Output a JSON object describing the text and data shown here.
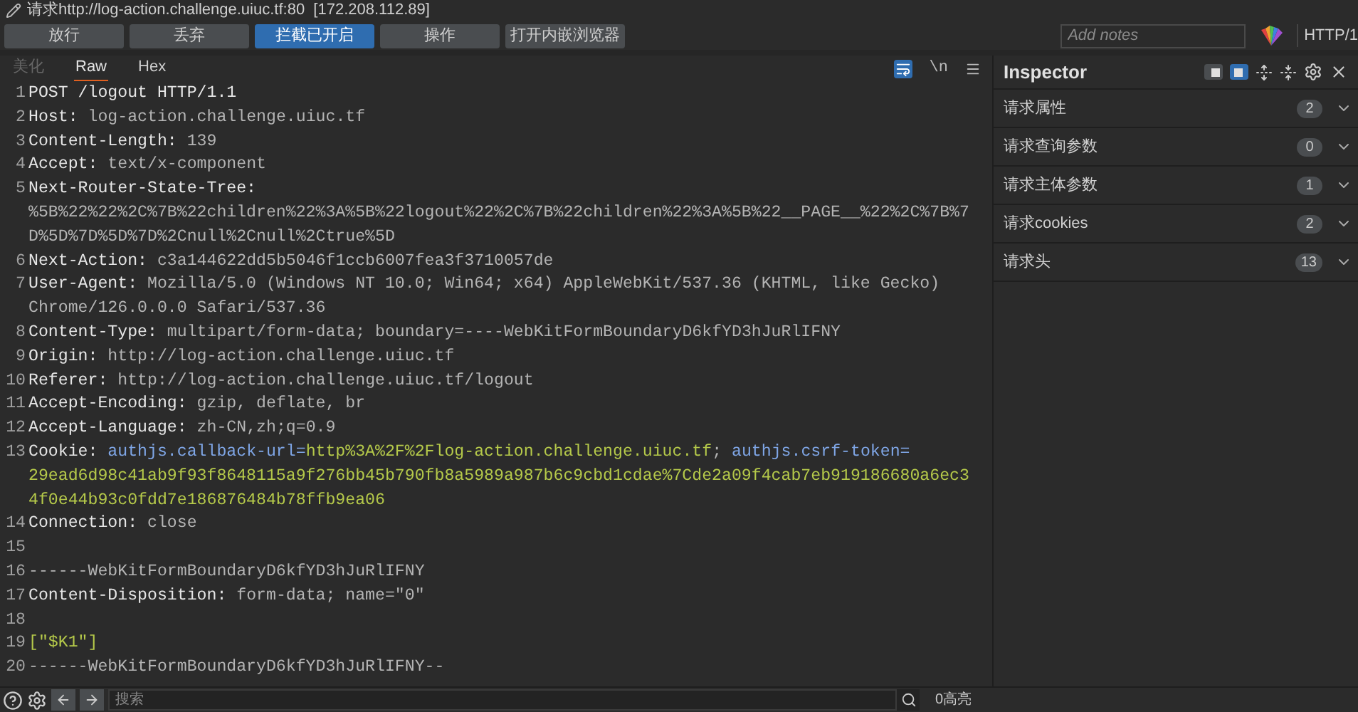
{
  "title": "请求http://log-action.challenge.uiuc.tf:80  [172.208.112.89]",
  "buttons": [
    {
      "label": "放行",
      "selected": false
    },
    {
      "label": "丢弃",
      "selected": false
    },
    {
      "label": "拦截已开启",
      "selected": true
    },
    {
      "label": "操作",
      "selected": false
    },
    {
      "label": "打开内嵌浏览器",
      "selected": false
    }
  ],
  "notes": {
    "placeholder": "Add notes"
  },
  "protocol": "HTTP/1",
  "tabs": [
    {
      "label": "美化",
      "selected": false,
      "disabled": true
    },
    {
      "label": "Raw",
      "selected": true,
      "disabled": false
    },
    {
      "label": "Hex",
      "selected": false,
      "disabled": false
    }
  ],
  "editor_tools": [
    {
      "label": "\\n",
      "selected": false
    }
  ],
  "wrap_on": true,
  "lines": [
    {
      "number": "1",
      "segments": [
        {
          "kind": "name",
          "text": "POST /logout HTTP/1.1"
        }
      ]
    },
    {
      "number": "2",
      "segments": [
        {
          "kind": "name",
          "text": "Host:"
        },
        {
          "kind": "value",
          "text": " log-action.challenge.uiuc.tf"
        }
      ]
    },
    {
      "number": "3",
      "segments": [
        {
          "kind": "name",
          "text": "Content-Length:"
        },
        {
          "kind": "value",
          "text": " 139"
        }
      ]
    },
    {
      "number": "4",
      "segments": [
        {
          "kind": "name",
          "text": "Accept:"
        },
        {
          "kind": "value",
          "text": " text/x-component"
        }
      ]
    },
    {
      "number": "5",
      "segments": [
        {
          "kind": "name",
          "text": "Next-Router-State-Tree:"
        },
        {
          "kind": "value",
          "text": " %5B%22%22%2C%7B%22children%22%3A%5B%22logout%22%2C%7B%22children%22%3A%5B%22__PAGE__%22%2C%7B%7D%5D%7D%5D%7D%2Cnull%2Cnull%2Ctrue%5D"
        }
      ]
    },
    {
      "number": "6",
      "segments": [
        {
          "kind": "name",
          "text": "Next-Action:"
        },
        {
          "kind": "value",
          "text": " c3a144622dd5b5046f1ccb6007fea3f3710057de"
        }
      ]
    },
    {
      "number": "7",
      "segments": [
        {
          "kind": "name",
          "text": "User-Agent:"
        },
        {
          "kind": "value",
          "text": " Mozilla/5.0 (Windows NT 10.0; Win64; x64) AppleWebKit/537.36 (KHTML, like Gecko) Chrome/126.0.0.0 Safari/537.36"
        }
      ]
    },
    {
      "number": "8",
      "segments": [
        {
          "kind": "name",
          "text": "Content-Type:"
        },
        {
          "kind": "value",
          "text": " multipart/form-data; boundary=----WebKitFormBoundaryD6kfYD3hJuRlIFNY"
        }
      ]
    },
    {
      "number": "9",
      "segments": [
        {
          "kind": "name",
          "text": "Origin:"
        },
        {
          "kind": "value",
          "text": " http://log-action.challenge.uiuc.tf"
        }
      ]
    },
    {
      "number": "10",
      "segments": [
        {
          "kind": "name",
          "text": "Referer:"
        },
        {
          "kind": "value",
          "text": " http://log-action.challenge.uiuc.tf/logout"
        }
      ]
    },
    {
      "number": "11",
      "segments": [
        {
          "kind": "name",
          "text": "Accept-Encoding:"
        },
        {
          "kind": "value",
          "text": " gzip, deflate, br"
        }
      ]
    },
    {
      "number": "12",
      "segments": [
        {
          "kind": "name",
          "text": "Accept-Language:"
        },
        {
          "kind": "value",
          "text": " zh-CN,zh;q=0.9"
        }
      ]
    },
    {
      "number": "13",
      "segments": [
        {
          "kind": "name",
          "text": "Cookie:"
        },
        {
          "kind": "cookie_name",
          "text": " authjs.callback-url="
        },
        {
          "kind": "string",
          "text": "http%3A%2F%2Flog-action.challenge.uiuc.tf"
        },
        {
          "kind": "value",
          "text": "; "
        },
        {
          "kind": "cookie_name",
          "text": "authjs.csrf-token="
        },
        {
          "kind": "string",
          "text": "29ead6d98c41ab9f93f8648115a9f276bb45b790fb8a5989a987b6c9cbd1cdae%7Cde2a09f4cab7eb919186680a6ec34f0e44b93c0fdd7e186876484b78ffb9ea06"
        }
      ]
    },
    {
      "number": "14",
      "segments": [
        {
          "kind": "name",
          "text": "Connection:"
        },
        {
          "kind": "value",
          "text": " close"
        }
      ]
    },
    {
      "number": "15"
    },
    {
      "number": "16",
      "segments": [
        {
          "kind": "value",
          "text": "------WebKitFormBoundaryD6kfYD3hJuRlIFNY"
        }
      ]
    },
    {
      "number": "17",
      "segments": [
        {
          "kind": "name",
          "text": "Content-Disposition:"
        },
        {
          "kind": "value",
          "text": " form-data; name=\"0\""
        }
      ]
    },
    {
      "number": "18"
    },
    {
      "number": "19",
      "segments": [
        {
          "kind": "string",
          "text": "[\"$K1\"]"
        }
      ]
    },
    {
      "number": "20",
      "segments": [
        {
          "kind": "value",
          "text": "------WebKitFormBoundaryD6kfYD3hJuRlIFNY--"
        }
      ]
    }
  ],
  "inspector": {
    "title": "Inspector",
    "layouts": [
      {
        "selected": false
      },
      {
        "selected": true
      }
    ],
    "sections": [
      {
        "label": "请求属性",
        "count": "2",
        "expanded": false
      },
      {
        "label": "请求查询参数",
        "count": "0",
        "expanded": false
      },
      {
        "label": "请求主体参数",
        "count": "1",
        "expanded": false
      },
      {
        "label": "请求cookies",
        "count": "2",
        "expanded": false
      },
      {
        "label": "请求头",
        "count": "13",
        "expanded": false
      }
    ]
  },
  "search": {
    "placeholder": "搜索"
  },
  "highlights": "0高亮"
}
